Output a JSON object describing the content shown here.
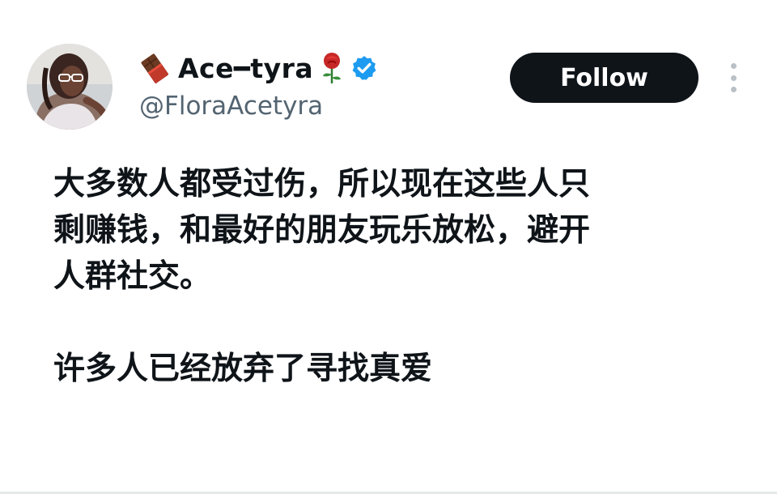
{
  "author": {
    "display_name": "Ace━tyra",
    "handle": "@FloraAcetyra",
    "verified": true,
    "name_prefix_icon": "chocolate-bar-icon",
    "name_suffix_icon": "rose-icon",
    "verified_icon": "verified-badge-icon",
    "verified_color": "#1d9bf0"
  },
  "actions": {
    "follow_label": "Follow",
    "more_icon": "more-vertical-icon"
  },
  "tweet": {
    "paragraph1_lines": [
      "大多数人都受过伤，所以现在这些人只",
      "剩赚钱，和最好的朋友玩乐放松，避开",
      "人群社交。"
    ],
    "paragraph2_lines": [
      "许多人已经放弃了寻找真爱"
    ]
  },
  "colors": {
    "text": "#0f1419",
    "secondary_text": "#536471",
    "follow_button_bg": "#0f1419",
    "follow_button_text": "#ffffff"
  }
}
